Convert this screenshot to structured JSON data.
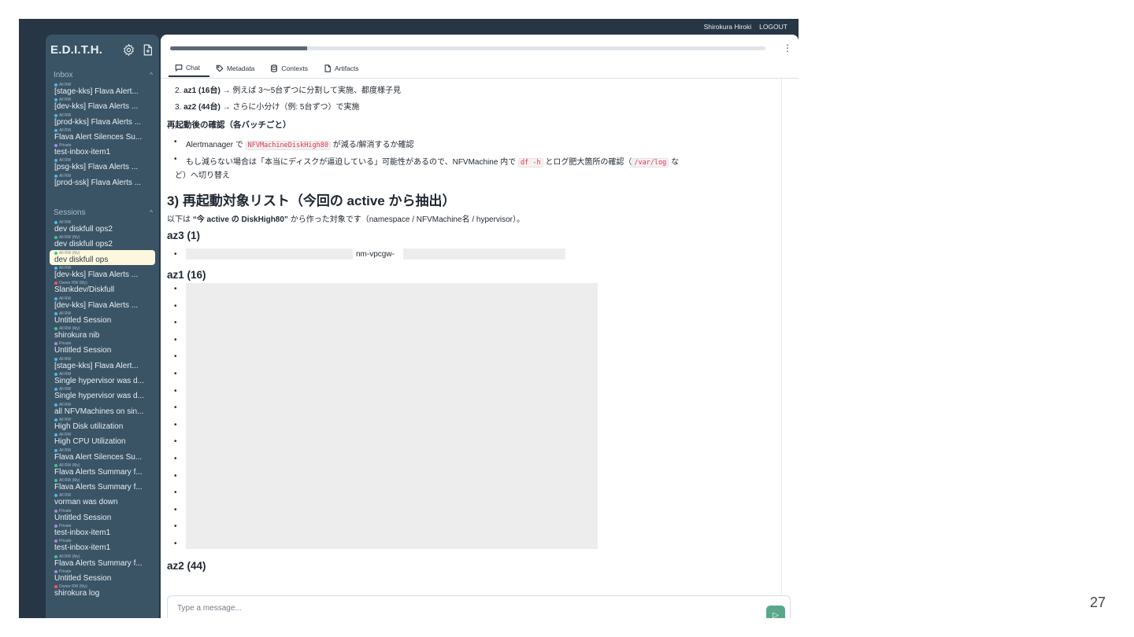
{
  "topbar": {
    "user": "Shirokura Hiroki",
    "logout": "LOGOUT"
  },
  "sidebar": {
    "brand": "E.D.I.T.H.",
    "inbox_header": "Inbox",
    "sessions_header": "Sessions",
    "inbox_items": [
      {
        "badge": "All RW",
        "label": "[stage-kks] Flava Alert...",
        "dot": "#52b6e8"
      },
      {
        "badge": "All RW",
        "label": "[dev-kks] Flava Alerts ...",
        "dot": "#52b6e8"
      },
      {
        "badge": "All RW",
        "label": "[prod-kks] Flava Alerts ...",
        "dot": "#52b6e8"
      },
      {
        "badge": "All RW",
        "label": "Flava Alert Silences Su...",
        "dot": "#52b6e8"
      },
      {
        "badge": "Private",
        "label": "test-inbox-item1",
        "dot": "#a78be0"
      },
      {
        "badge": "All RW",
        "label": "[psg-kks] Flava Alerts ...",
        "dot": "#52b6e8"
      },
      {
        "badge": "All RW",
        "label": "[prod-ssk] Flava Alerts ...",
        "dot": "#52b6e8"
      }
    ],
    "session_items": [
      {
        "badge": "All RW",
        "label": "dev diskfull ops2",
        "dot": "#52b6e8"
      },
      {
        "badge": "All RW (My)",
        "label": "dev diskfull ops2",
        "dot": "#3ec88a"
      },
      {
        "badge": "All RW (My)",
        "label": "dev diskfull ops",
        "dot": "#3ec88a",
        "active": true
      },
      {
        "badge": "All RW",
        "label": "[dev-kks] Flava Alerts ...",
        "dot": "#52b6e8"
      },
      {
        "badge": "Owner RW (My)",
        "label": "Slankdev/Diskfull",
        "dot": "#f05a5a"
      },
      {
        "badge": "All RW",
        "label": "[dev-kks] Flava Alerts ...",
        "dot": "#52b6e8"
      },
      {
        "badge": "All RW",
        "label": "Untitled Session",
        "dot": "#52b6e8"
      },
      {
        "badge": "All RW (My)",
        "label": "shirokura nib",
        "dot": "#3ec88a"
      },
      {
        "badge": "Private",
        "label": "Untitled Session",
        "dot": "#a78be0"
      },
      {
        "badge": "All RW",
        "label": "[stage-kks] Flava Alert...",
        "dot": "#52b6e8"
      },
      {
        "badge": "All RW",
        "label": "Single hypervisor was d...",
        "dot": "#52b6e8"
      },
      {
        "badge": "All RW",
        "label": "Single hypervisor was d...",
        "dot": "#52b6e8"
      },
      {
        "badge": "All RW",
        "label": "all NFVMachines on sin...",
        "dot": "#52b6e8"
      },
      {
        "badge": "All RW",
        "label": "High Disk utilization",
        "dot": "#52b6e8"
      },
      {
        "badge": "All RW",
        "label": "High CPU Utilization",
        "dot": "#52b6e8"
      },
      {
        "badge": "All RW",
        "label": "Flava Alert Silences Su...",
        "dot": "#52b6e8"
      },
      {
        "badge": "All RW (My)",
        "label": "Flava Alerts Summary f...",
        "dot": "#3ec88a"
      },
      {
        "badge": "All RW (My)",
        "label": "Flava Alerts Summary f...",
        "dot": "#3ec88a"
      },
      {
        "badge": "All RW",
        "label": "vorman was down",
        "dot": "#52b6e8"
      },
      {
        "badge": "Private",
        "label": "Untitled Session",
        "dot": "#a78be0"
      },
      {
        "badge": "Private",
        "label": "test-inbox-item1",
        "dot": "#a78be0"
      },
      {
        "badge": "Private",
        "label": "test-inbox-item1",
        "dot": "#a78be0"
      },
      {
        "badge": "All RW (My)",
        "label": "Flava Alerts Summary f...",
        "dot": "#3ec88a"
      },
      {
        "badge": "Private",
        "label": "Untitled Session",
        "dot": "#a78be0"
      },
      {
        "badge": "Owner RW (My)",
        "label": "shirokura log",
        "dot": "#f05a5a"
      }
    ]
  },
  "tabs": [
    "Chat",
    "Metadata",
    "Contexts",
    "Artifacts"
  ],
  "progress": {
    "fraction": 0.23
  },
  "content": {
    "l1_prefix": "2. ",
    "l1_bold": "az1 (16台)",
    "l1_rest": " → 例えば 3〜5台ずつに分割して実施、都度様子見",
    "l2_prefix": "3. ",
    "l2_bold": "az2 (44台)",
    "l2_rest": " → さらに小分け（例: 5台ずつ）で実施",
    "sub1": "再起動後の確認（各バッチごと）",
    "b1_a": "Alertmanager で ",
    "b1_code": "NFVMachineDiskHigh80",
    "b1_b": " が減る/解消するか確認",
    "b2_a": "もし減らない場合は「本当にディスクが逼迫している」可能性があるので、NFVMachine 内で ",
    "b2_code1": "df -h",
    "b2_b": " とログ肥大箇所の確認（",
    "b2_code2": "/var/log",
    "b2_c": " な",
    "b2_d": "ど）へ切り替え",
    "h3": "3) 再起動対象リスト（今回の active から抽出）",
    "p1_a": "以下は ",
    "p1_bold": "“今 active の DiskHigh80”",
    "p1_b": " から作った対象です（namespace / NFVMachine名 / hypervisor）。",
    "az3": "az3 (1)",
    "az3_item": "nm-vpcgw-",
    "az1": "az1 (16)",
    "az2": "az2 (44)"
  },
  "composer": {
    "placeholder": "Type a message..."
  },
  "page_number": "27"
}
